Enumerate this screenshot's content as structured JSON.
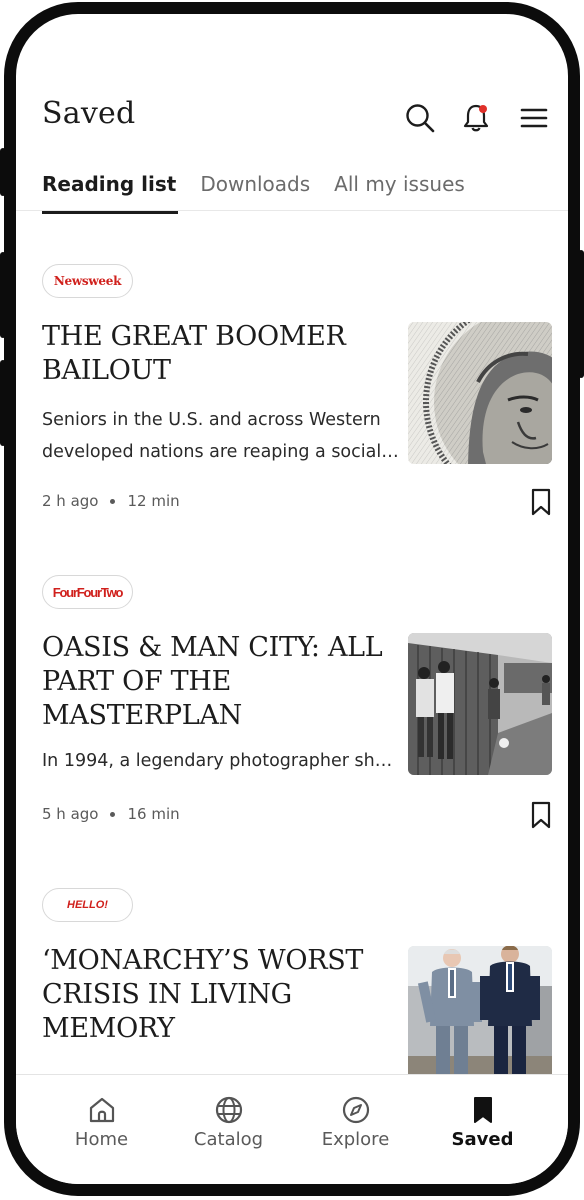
{
  "header": {
    "title": "Saved",
    "icons": [
      "search-icon",
      "bell-icon",
      "menu-icon"
    ],
    "notification_dot_color": "#e0302a"
  },
  "tabs": [
    {
      "label": "Reading list",
      "active": true
    },
    {
      "label": "Downloads",
      "active": false
    },
    {
      "label": "All my issues",
      "active": false
    }
  ],
  "articles": [
    {
      "publication": "Newsweek",
      "headline": "THE GREAT BOOMER BAILOUT",
      "summary": "Seniors in the U.S. and across Western developed nations are reaping a social s…",
      "time_ago": "2 h ago",
      "read_time": "12 min",
      "image": "banknote-portrait"
    },
    {
      "publication": "FourFourTwo",
      "headline": "OASIS & MAN CITY: ALL PART OF THE MASTERPLAN",
      "summary": "In 1994, a legendary photographer shot s…",
      "time_ago": "5 h ago",
      "read_time": "16 min",
      "image": "black-and-white-street-photo"
    },
    {
      "publication": "HELLO!",
      "headline": "‘MONARCHY’S WORST CRISIS IN LIVING MEMORY",
      "image": "two-men-in-suits-walking"
    }
  ],
  "bottom_nav": [
    {
      "label": "Home",
      "icon": "home-icon",
      "active": false
    },
    {
      "label": "Catalog",
      "icon": "globe-icon",
      "active": false
    },
    {
      "label": "Explore",
      "icon": "compass-icon",
      "active": false
    },
    {
      "label": "Saved",
      "icon": "bookmark-icon",
      "active": true
    }
  ],
  "colors": {
    "brand_red": "#d0201c",
    "text": "#1c1c1c",
    "muted": "#6b6b6b"
  }
}
